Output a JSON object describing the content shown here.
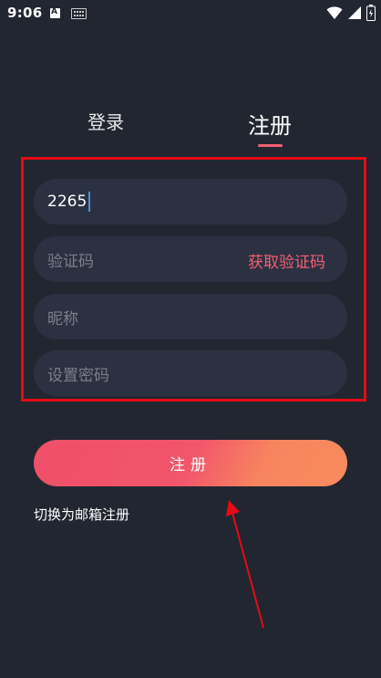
{
  "status_bar": {
    "time": "9:06",
    "notif_letter": "A",
    "icons": [
      "a-notification-icon",
      "keyboard-icon",
      "wifi-icon",
      "cellular-signal-icon",
      "battery-icon"
    ]
  },
  "tabs": {
    "login": "登录",
    "register": "注册",
    "active": "register"
  },
  "form": {
    "phone_value": "2265",
    "code_placeholder": "验证码",
    "get_code_label": "获取验证码",
    "nickname_placeholder": "昵称",
    "password_placeholder": "设置密码"
  },
  "submit_label": "注册",
  "switch_label": "切换为邮箱注册",
  "colors": {
    "background": "#222631",
    "field": "#2c3142",
    "accent": "#f06071",
    "annotation": "#e60b15",
    "button_start": "#f04f6a",
    "button_end": "#f98b5e"
  }
}
